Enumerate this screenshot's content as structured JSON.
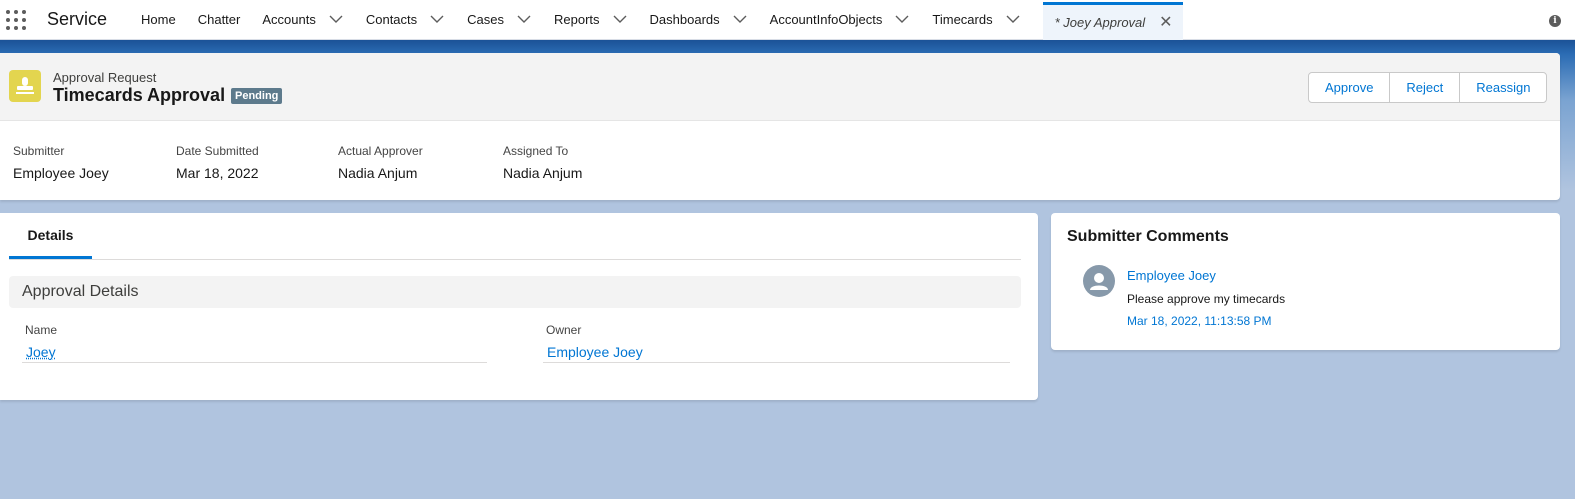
{
  "nav": {
    "app_name": "Service",
    "items": [
      {
        "label": "Home",
        "has_menu": false
      },
      {
        "label": "Chatter",
        "has_menu": false
      },
      {
        "label": "Accounts",
        "has_menu": true
      },
      {
        "label": "Contacts",
        "has_menu": true
      },
      {
        "label": "Cases",
        "has_menu": true
      },
      {
        "label": "Reports",
        "has_menu": true
      },
      {
        "label": "Dashboards",
        "has_menu": true
      },
      {
        "label": "AccountInfoObjects",
        "has_menu": true
      },
      {
        "label": "Timecards",
        "has_menu": true
      }
    ],
    "active_tab": {
      "label": "* Joey Approval",
      "close_glyph": "✕"
    },
    "info_glyph": "i"
  },
  "header": {
    "object_label": "Approval Request",
    "title": "Timecards Approval",
    "status": "Pending",
    "actions": [
      "Approve",
      "Reject",
      "Reassign"
    ],
    "fields": [
      {
        "label": "Submitter",
        "value": "Employee Joey"
      },
      {
        "label": "Date Submitted",
        "value": "Mar 18, 2022"
      },
      {
        "label": "Actual Approver",
        "value": "Nadia Anjum"
      },
      {
        "label": "Assigned To",
        "value": "Nadia Anjum"
      }
    ]
  },
  "details": {
    "tab_label": "Details",
    "section_title": "Approval Details",
    "fields": [
      {
        "label": "Name",
        "value": "Joey"
      },
      {
        "label": "Owner",
        "value": "Employee Joey"
      }
    ]
  },
  "comments": {
    "title": "Submitter Comments",
    "author": "Employee Joey",
    "text": "Please approve my timecards",
    "timestamp": "Mar 18, 2022, 11:13:58 PM"
  },
  "colors": {
    "brand_blue": "#0176d3",
    "record_icon": "#e3d54f",
    "status_badge": "#5d7a8c"
  }
}
